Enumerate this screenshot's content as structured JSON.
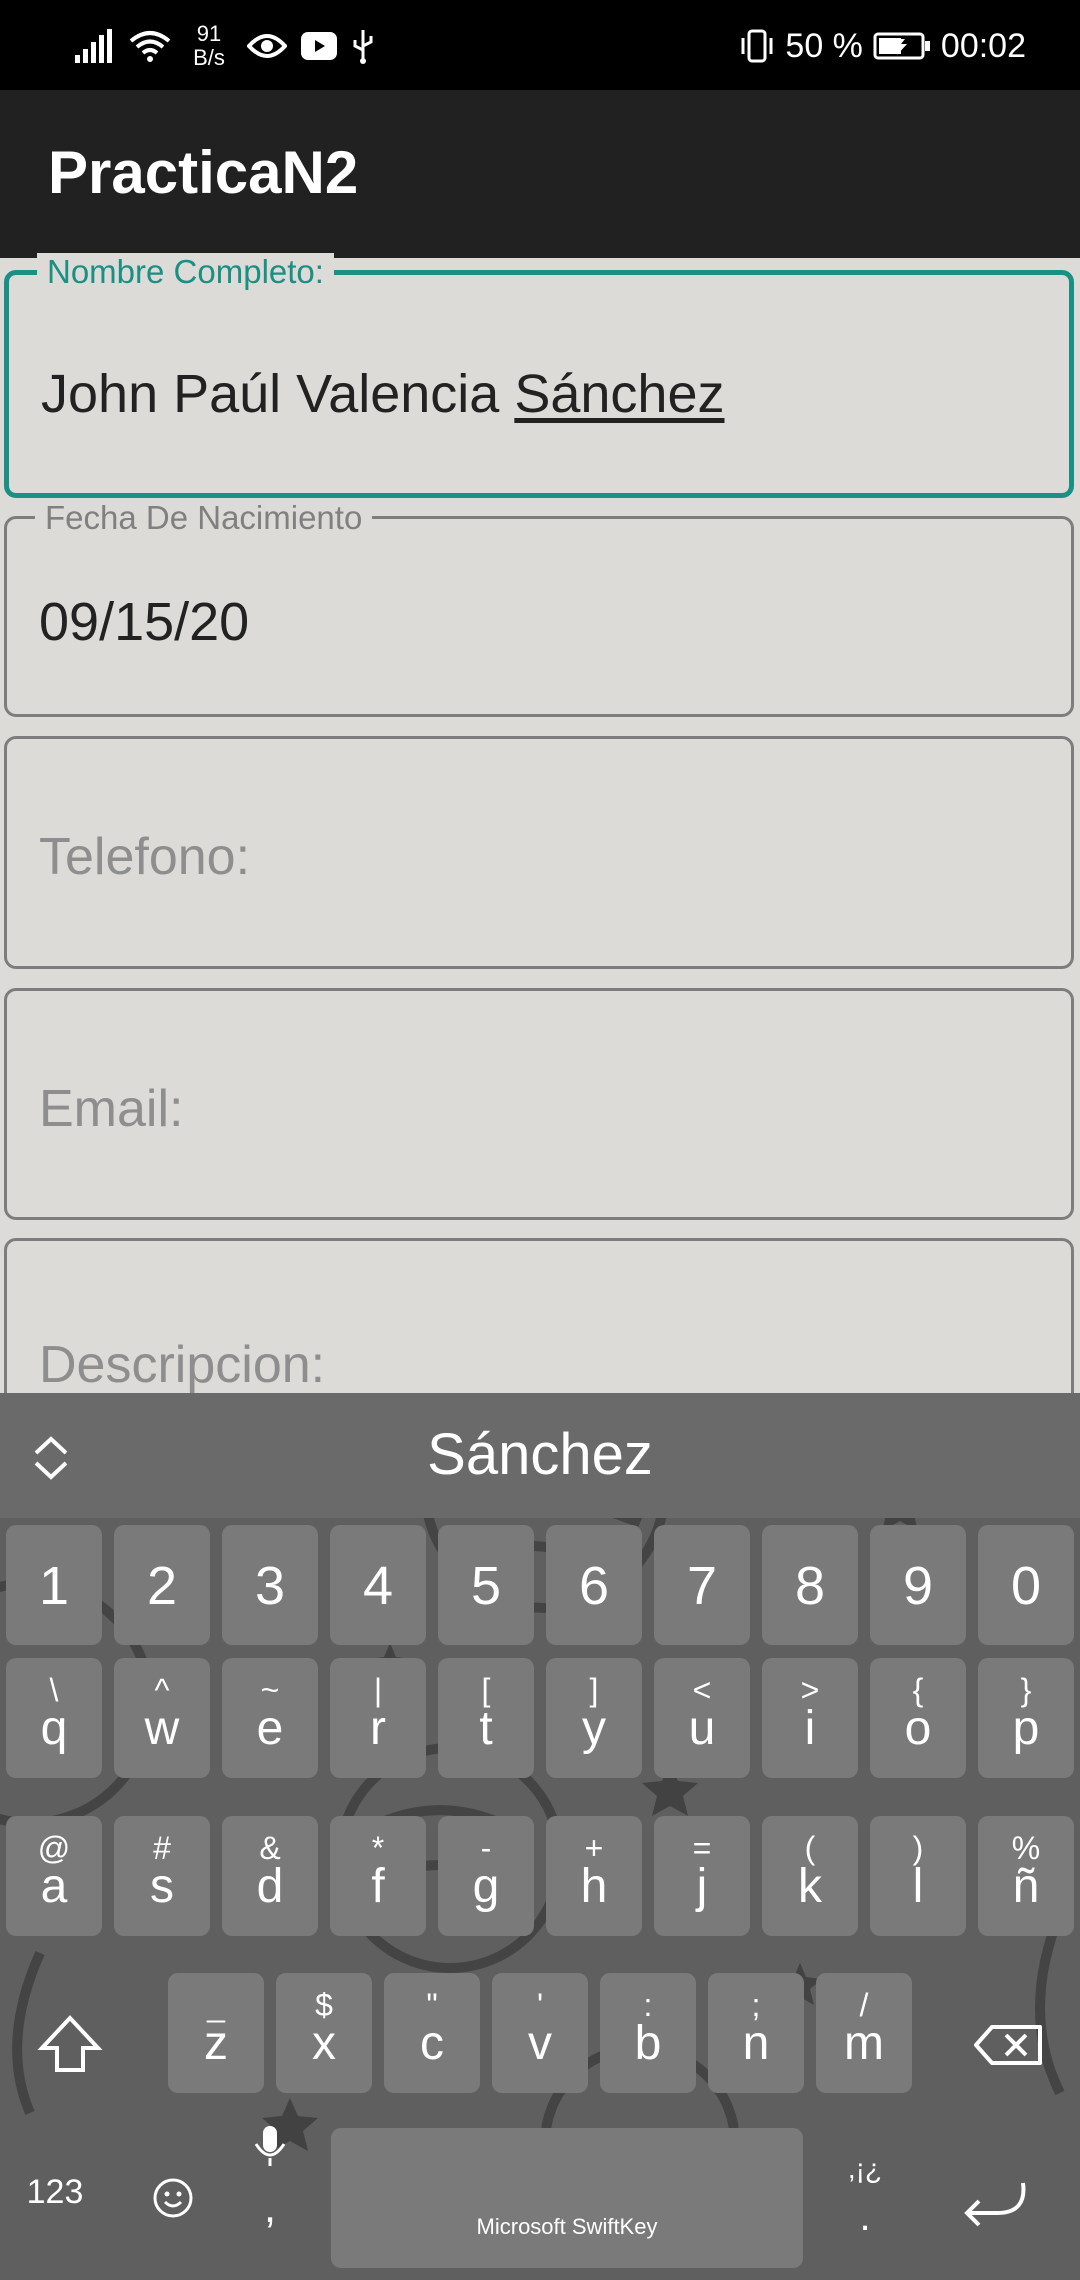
{
  "status_bar": {
    "net_speed_value": "91",
    "net_speed_unit": "B/s",
    "battery": "50 %",
    "time": "00:02",
    "icons": [
      "signal-icon",
      "wifi-icon",
      "eye-icon",
      "youtube-icon",
      "usb-icon",
      "vibrate-icon",
      "battery-icon"
    ]
  },
  "app_bar": {
    "title": "PracticaN2"
  },
  "form": {
    "nombre": {
      "label": "Nombre Completo:",
      "value_plain": "John Paúl Valencia ",
      "value_underlined": "Sánchez"
    },
    "fecha": {
      "label": "Fecha De Nacimiento",
      "value": "09/15/20"
    },
    "telefono": {
      "placeholder": "Telefono:"
    },
    "email": {
      "placeholder": "Email:"
    },
    "descripcion": {
      "placeholder": "Descripcion:"
    }
  },
  "keyboard": {
    "suggestion": "Sánchez",
    "row_numbers": [
      "1",
      "2",
      "3",
      "4",
      "5",
      "6",
      "7",
      "8",
      "9",
      "0"
    ],
    "row_q": [
      {
        "main": "q",
        "alt": "\\"
      },
      {
        "main": "w",
        "alt": "^"
      },
      {
        "main": "e",
        "alt": "~"
      },
      {
        "main": "r",
        "alt": "|"
      },
      {
        "main": "t",
        "alt": "["
      },
      {
        "main": "y",
        "alt": "]"
      },
      {
        "main": "u",
        "alt": "<"
      },
      {
        "main": "i",
        "alt": ">"
      },
      {
        "main": "o",
        "alt": "{"
      },
      {
        "main": "p",
        "alt": "}"
      }
    ],
    "row_a": [
      {
        "main": "a",
        "alt": "@"
      },
      {
        "main": "s",
        "alt": "#"
      },
      {
        "main": "d",
        "alt": "&"
      },
      {
        "main": "f",
        "alt": "*"
      },
      {
        "main": "g",
        "alt": "-"
      },
      {
        "main": "h",
        "alt": "+"
      },
      {
        "main": "j",
        "alt": "="
      },
      {
        "main": "k",
        "alt": "("
      },
      {
        "main": "l",
        "alt": ")"
      },
      {
        "main": "ñ",
        "alt": "%"
      }
    ],
    "row_z": [
      {
        "main": "z",
        "alt": "_"
      },
      {
        "main": "x",
        "alt": "$"
      },
      {
        "main": "c",
        "alt": "\""
      },
      {
        "main": "v",
        "alt": "'"
      },
      {
        "main": "b",
        "alt": ":"
      },
      {
        "main": "n",
        "alt": ";"
      },
      {
        "main": "m",
        "alt": "/"
      }
    ],
    "numbers_label": "123",
    "comma_label": ",",
    "punct_alt": ",¡¿",
    "period_label": ".",
    "space_label": "Microsoft SwiftKey"
  }
}
